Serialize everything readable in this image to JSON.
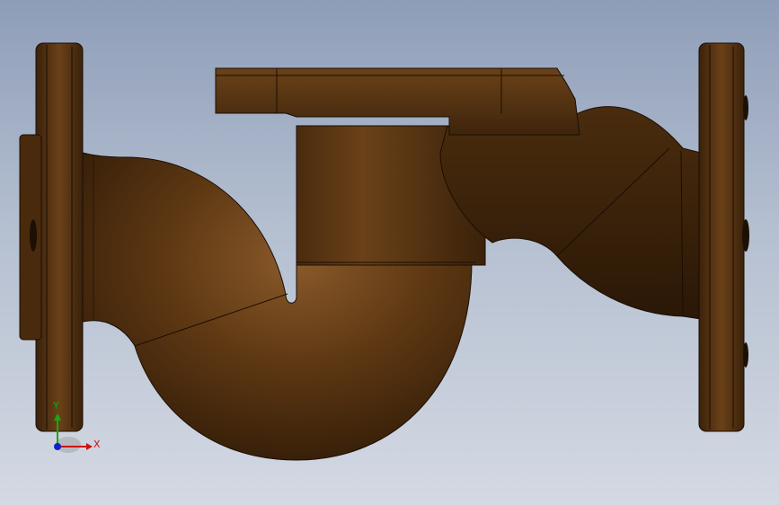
{
  "viewport": {
    "background_top": "#8e9db8",
    "background_bottom": "#d4d9e3"
  },
  "model": {
    "body_color": "#5a3512",
    "body_dark": "#2e1a08",
    "body_light": "#8a5a2a",
    "edge_color": "#1a0e04"
  },
  "triad": {
    "x_label": "X",
    "y_label": "Y",
    "x_color": "#cc1111",
    "y_color": "#11aa11",
    "z_color": "#1122cc"
  }
}
